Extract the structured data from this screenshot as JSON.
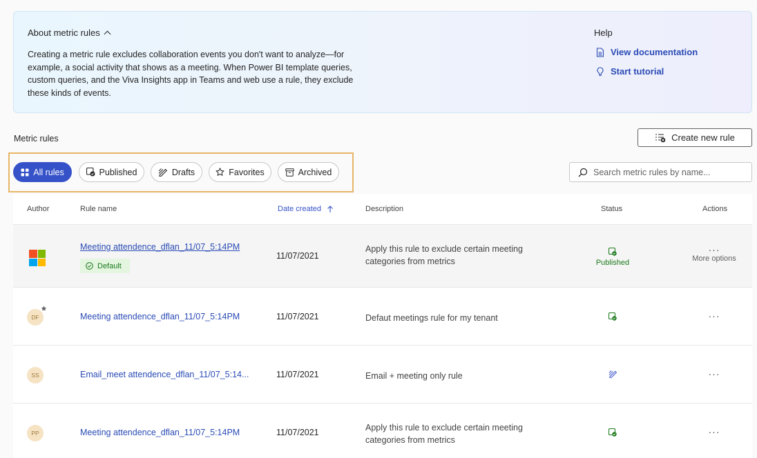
{
  "about": {
    "title": "About metric rules",
    "text": "Creating a metric rule excludes collaboration events you don't want to analyze—for example, a social activity that shows as a meeting. When Power BI template queries, custom queries, and the Viva Insights app in Teams and web use a rule, they exclude these kinds of events."
  },
  "help": {
    "title": "Help",
    "documentation": "View documentation",
    "tutorial": "Start tutorial"
  },
  "section": {
    "title": "Metric rules",
    "create_label": "Create new rule"
  },
  "filters": [
    {
      "label": "All rules",
      "icon": "grid-icon",
      "active": true
    },
    {
      "label": "Published",
      "icon": "published-icon",
      "active": false
    },
    {
      "label": "Drafts",
      "icon": "draft-icon",
      "active": false
    },
    {
      "label": "Favorites",
      "icon": "star-icon",
      "active": false
    },
    {
      "label": "Archived",
      "icon": "archive-icon",
      "active": false
    }
  ],
  "search": {
    "placeholder": "Search metric rules by name..."
  },
  "columns": {
    "author": "Author",
    "rule_name": "Rule name",
    "date_created": "Date created",
    "description": "Description",
    "status": "Status",
    "actions": "Actions"
  },
  "rows": [
    {
      "author": "",
      "rule_name": "Meeting attendence_dflan_11/07_5:14PM",
      "badge": "Default",
      "date": "11/07/2021",
      "description": "Apply this rule to exclude certain meeting categories from metrics",
      "status": "Published",
      "status_icon": "published-icon",
      "action_label": "More options"
    },
    {
      "author": "DF",
      "rule_name": "Meeting attendence_dflan_11/07_5:14PM",
      "date": "11/07/2021",
      "description": "Defaut meetings rule for my tenant",
      "status_icon": "published-icon"
    },
    {
      "author": "SS",
      "rule_name": "Email_meet attendence_dflan_11/07_5:14...",
      "date": "11/07/2021",
      "description": "Email + meeting only rule",
      "status_icon": "draft-icon"
    },
    {
      "author": "PP",
      "rule_name": "Meeting attendence_dflan_11/07_5:14PM",
      "date": "11/07/2021",
      "description": "Apply this rule to exclude certain meeting categories from metrics",
      "status_icon": "published-icon"
    }
  ],
  "colors": {
    "accent": "#3652c9",
    "link": "#2a4bb5",
    "success": "#1c7a1c",
    "highlight_frame": "#e8b667"
  }
}
